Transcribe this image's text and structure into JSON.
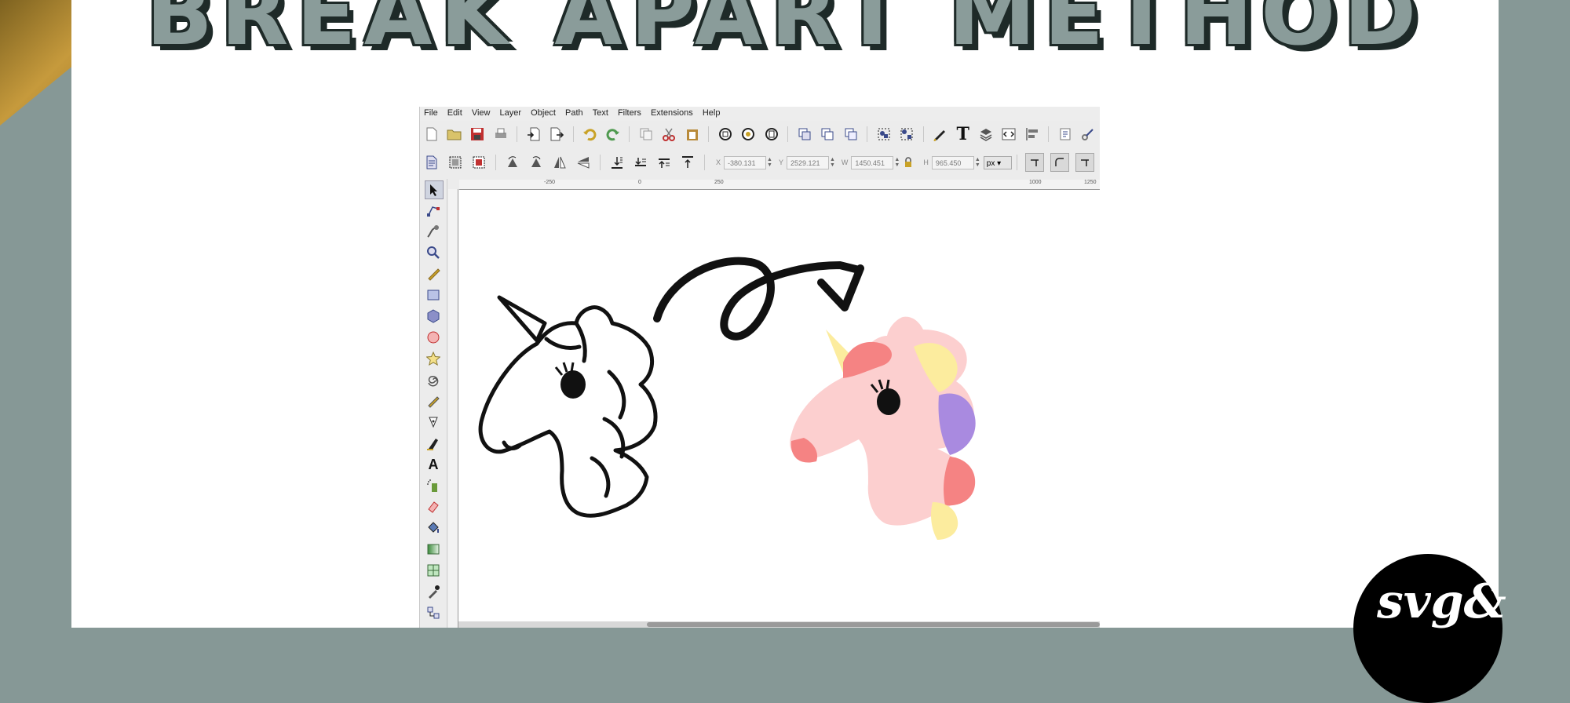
{
  "title": "BREAK APART METHOD",
  "menu": [
    "File",
    "Edit",
    "View",
    "Layer",
    "Object",
    "Path",
    "Text",
    "Filters",
    "Extensions",
    "Help"
  ],
  "coords": {
    "x_label": "X",
    "x_value": "-380.131",
    "y_label": "Y",
    "y_value": "2529.121",
    "w_label": "W",
    "w_value": "1450.451",
    "h_label": "H",
    "h_value": "965.450",
    "unit": "px"
  },
  "ruler": {
    "m250": "-250",
    "zero": "0",
    "p250": "250",
    "p1000": "1000",
    "p1250": "1250"
  },
  "logo_text": "svg&",
  "colors": {
    "background": "#869896",
    "title_fill": "#8a9c9a",
    "unicorn_pink": "#fccfcf",
    "mane_coral": "#f58383",
    "mane_yellow": "#fcec9e",
    "mane_purple": "#a98ae0"
  }
}
